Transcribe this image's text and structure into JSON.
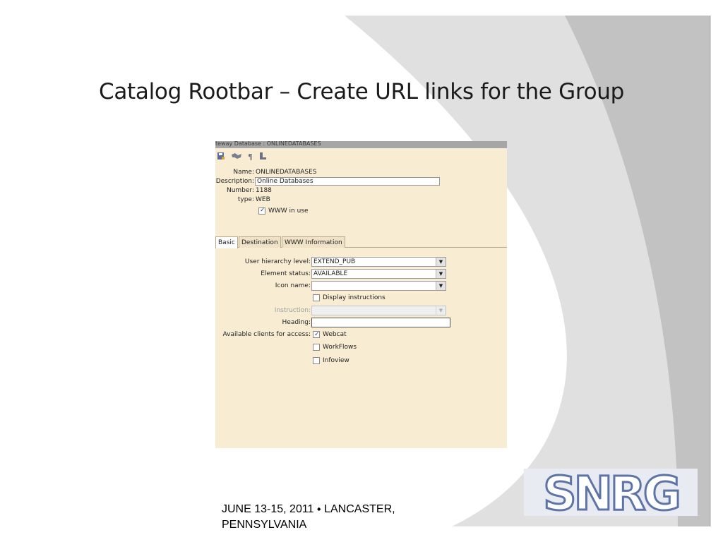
{
  "slide": {
    "title": "Catalog Rootbar – Create URL links for the Group",
    "footer": "JUNE 13-15, 2011 ⬩ LANCASTER, PENNSYLVANIA",
    "logo_text": "SNRG"
  },
  "app": {
    "window_title": "teway Database : ONLINEDATABASES",
    "toolbar_icons": [
      "save-icon",
      "handshake-icon",
      "pilcrow-icon",
      "stack-icon"
    ],
    "fields": {
      "name_label": "Name:",
      "name_value": "ONLINEDATABASES",
      "description_label": "Description:",
      "description_value": "Online Databases",
      "number_label": "Number:",
      "number_value": "1188",
      "type_label": "type:",
      "type_value": "WEB",
      "www_in_use_label": "WWW in use",
      "www_in_use_checked": true
    },
    "tabs": [
      {
        "label": "Basic",
        "active": true
      },
      {
        "label": "Destination",
        "active": false
      },
      {
        "label": "WWW Information",
        "active": false
      }
    ],
    "basic": {
      "user_hierarchy_label": "User hierarchy level:",
      "user_hierarchy_value": "EXTEND_PUB",
      "element_status_label": "Element status:",
      "element_status_value": "AVAILABLE",
      "icon_name_label": "Icon name:",
      "icon_name_value": "",
      "display_instructions_label": "Display instructions",
      "display_instructions_checked": false,
      "instruction_label": "Instruction:",
      "instruction_value": "",
      "heading_label": "Heading:",
      "heading_value": "",
      "clients_label": "Available clients for access:",
      "clients": [
        {
          "label": "Webcat",
          "checked": true
        },
        {
          "label": "WorkFlows",
          "checked": false
        },
        {
          "label": "Infoview",
          "checked": false
        }
      ]
    }
  },
  "colors": {
    "panel_bg": "#f8ecd3",
    "swoosh_light": "#dcdcdc",
    "swoosh_dark": "#b8b8b8",
    "logo_blue": "#5f74a6"
  }
}
